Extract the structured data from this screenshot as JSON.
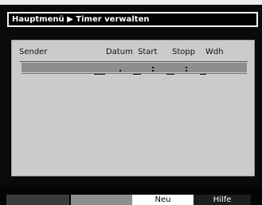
{
  "breadcrumb": {
    "root": "Hauptmenü",
    "separator": "▶",
    "current": "Timer verwalten"
  },
  "table": {
    "columns": {
      "sender": "Sender",
      "datum": "Datum",
      "start": "Start",
      "stopp": "Stopp",
      "wdh": "Wdh"
    }
  },
  "keys": {
    "red": "",
    "green": "",
    "yellow": "Neu",
    "blue": "Hilfe"
  },
  "colors": {
    "panel": "#cbcbcb",
    "selected_row": "#8e8e8e",
    "background": "#0a0a0a"
  }
}
